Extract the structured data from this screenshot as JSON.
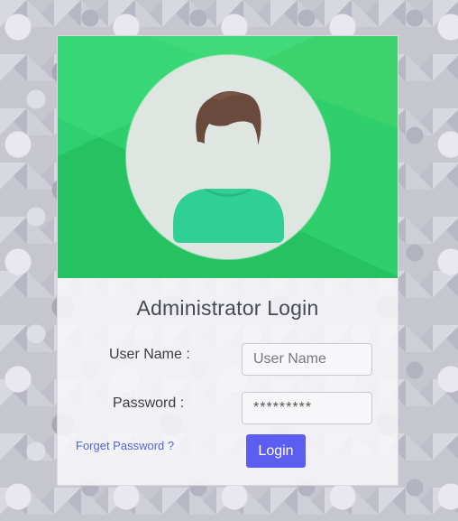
{
  "login": {
    "title": "Administrator Login",
    "username_label": "User Name :",
    "username_placeholder": "User Name",
    "password_label": "Password :",
    "password_value": "*********",
    "forget_link": "Forget Password ?",
    "login_button": "Login"
  },
  "colors": {
    "banner": "#2fcf6c",
    "button": "#5b5ef0",
    "link": "#5566d6",
    "avatar_shirt": "#2fcf96",
    "avatar_hair": "#6b4a3e"
  },
  "icons": {
    "avatar": "user-avatar-icon"
  }
}
